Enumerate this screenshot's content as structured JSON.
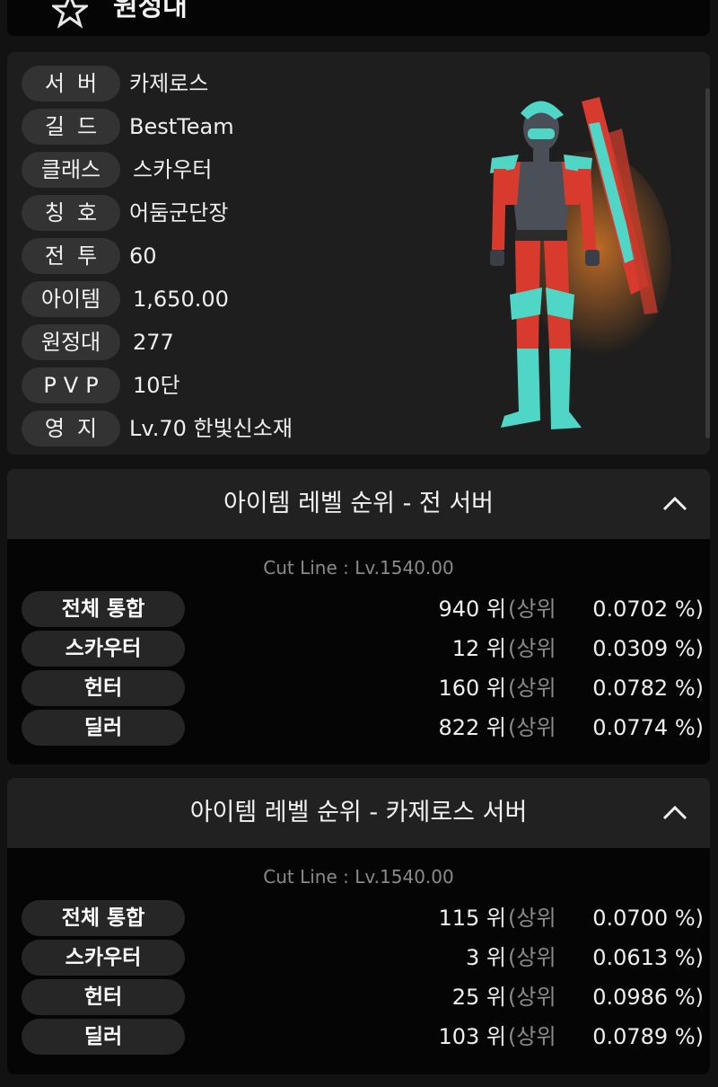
{
  "header": {
    "title": "원정대"
  },
  "profile": {
    "rows": [
      {
        "label": "서버",
        "value": "카제로스"
      },
      {
        "label": "길드",
        "value": "BestTeam"
      },
      {
        "label": "클래스",
        "value": "스카우터"
      },
      {
        "label": "칭호",
        "value": "어둠군단장"
      },
      {
        "label": "전투",
        "value": "60"
      },
      {
        "label": "아이템",
        "value": "1,650.00"
      },
      {
        "label": "원정대",
        "value": "277"
      },
      {
        "label": "PVP",
        "value": "10단"
      },
      {
        "label": "영지",
        "value": "Lv.70 한빛신소재"
      }
    ]
  },
  "rank_all": {
    "title": "아이템 레벨 순위 - 전 서버",
    "cutline": "Cut Line : Lv.1540.00",
    "rows": [
      {
        "label": "전체 통합",
        "rank": "940 위",
        "open": "(상위",
        "pct": "0.0702 %)"
      },
      {
        "label": "스카우터",
        "rank": "12 위",
        "open": "(상위",
        "pct": "0.0309 %)"
      },
      {
        "label": "헌터",
        "rank": "160 위",
        "open": "(상위",
        "pct": "0.0782 %)"
      },
      {
        "label": "딜러",
        "rank": "822 위",
        "open": "(상위",
        "pct": "0.0774 %)"
      }
    ]
  },
  "rank_server": {
    "title": "아이템 레벨 순위 - 카제로스 서버",
    "cutline": "Cut Line : Lv.1540.00",
    "rows": [
      {
        "label": "전체 통합",
        "rank": "115 위",
        "open": "(상위",
        "pct": "0.0700 %)"
      },
      {
        "label": "스카우터",
        "rank": "3 위",
        "open": "(상위",
        "pct": "0.0613 %)"
      },
      {
        "label": "헌터",
        "rank": "25 위",
        "open": "(상위",
        "pct": "0.0986 %)"
      },
      {
        "label": "딜러",
        "rank": "103 위",
        "open": "(상위",
        "pct": "0.0789 %)"
      }
    ]
  },
  "colors": {
    "pill": "#333333",
    "muted": "#8a8a8a",
    "armor_red": "#e0302a",
    "armor_teal": "#4fd6c6"
  }
}
